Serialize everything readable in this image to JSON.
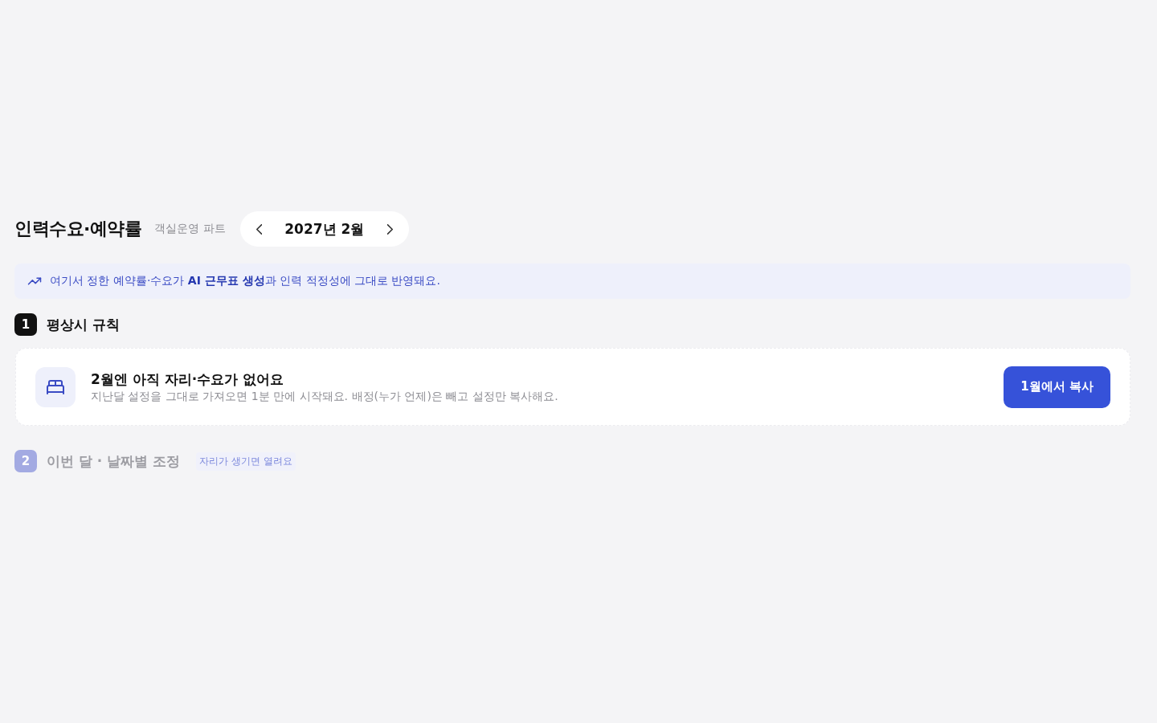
{
  "header": {
    "title": "인력수요·예약률",
    "subtitle": "객실운영 파트",
    "month_picker": {
      "label": "2027년 2월"
    }
  },
  "notice": {
    "text": "여기서 정한 예약률·수요가 **AI 근무표 생성**과 인력 적정성에 그대로 반영돼요."
  },
  "steps": [
    {
      "number": "1",
      "title": "평상시 규칙",
      "disabled": false,
      "card": {
        "title": "2월엔 아직 자리·수요가 없어요",
        "description": "지난달 설정을 그대로 가져오면 1분 만에 시작돼요. 배정(누가 언제)은 빼고 설정만 복사해요.",
        "button": "1월에서 복사"
      }
    },
    {
      "number": "2",
      "title": "이번 달 · 날짜별 조정",
      "disabled": true,
      "hint": "자리가 생기면 열려요"
    }
  ]
}
